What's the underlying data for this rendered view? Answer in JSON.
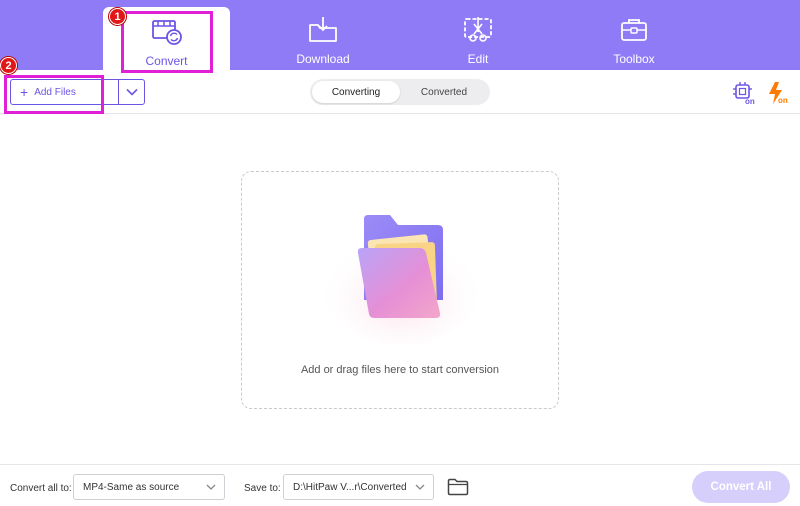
{
  "nav": {
    "items": [
      {
        "label": "Convert",
        "icon": "film-convert-icon"
      },
      {
        "label": "Download",
        "icon": "download-folder-icon"
      },
      {
        "label": "Edit",
        "icon": "edit-scissors-icon"
      },
      {
        "label": "Toolbox",
        "icon": "toolbox-icon"
      }
    ],
    "active_index": 0
  },
  "annotations": {
    "badge1": "1",
    "badge2": "2"
  },
  "toolbar": {
    "add_files_label": "Add Files",
    "tabs": [
      "Converting",
      "Converted"
    ],
    "active_tab": "Converting",
    "right_icons": [
      "hardware-acceleration-icon",
      "speed-on-icon"
    ],
    "hw_badge": "on",
    "speed_badge": "on"
  },
  "dropzone": {
    "text": "Add or drag files here to start conversion"
  },
  "bottom": {
    "convert_all_to_label": "Convert all to:",
    "format_value": "MP4-Same as source",
    "save_to_label": "Save to:",
    "save_path": "D:\\HitPaw V...r\\Converted",
    "convert_all_button": "Convert All"
  },
  "colors": {
    "accent": "#8f7bf6",
    "accent_dark": "#6b55e6",
    "annotation": "#e020d6",
    "badge": "#e01818",
    "speed_orange": "#ff7a00",
    "convert_all_disabled": "#d7cffb"
  }
}
